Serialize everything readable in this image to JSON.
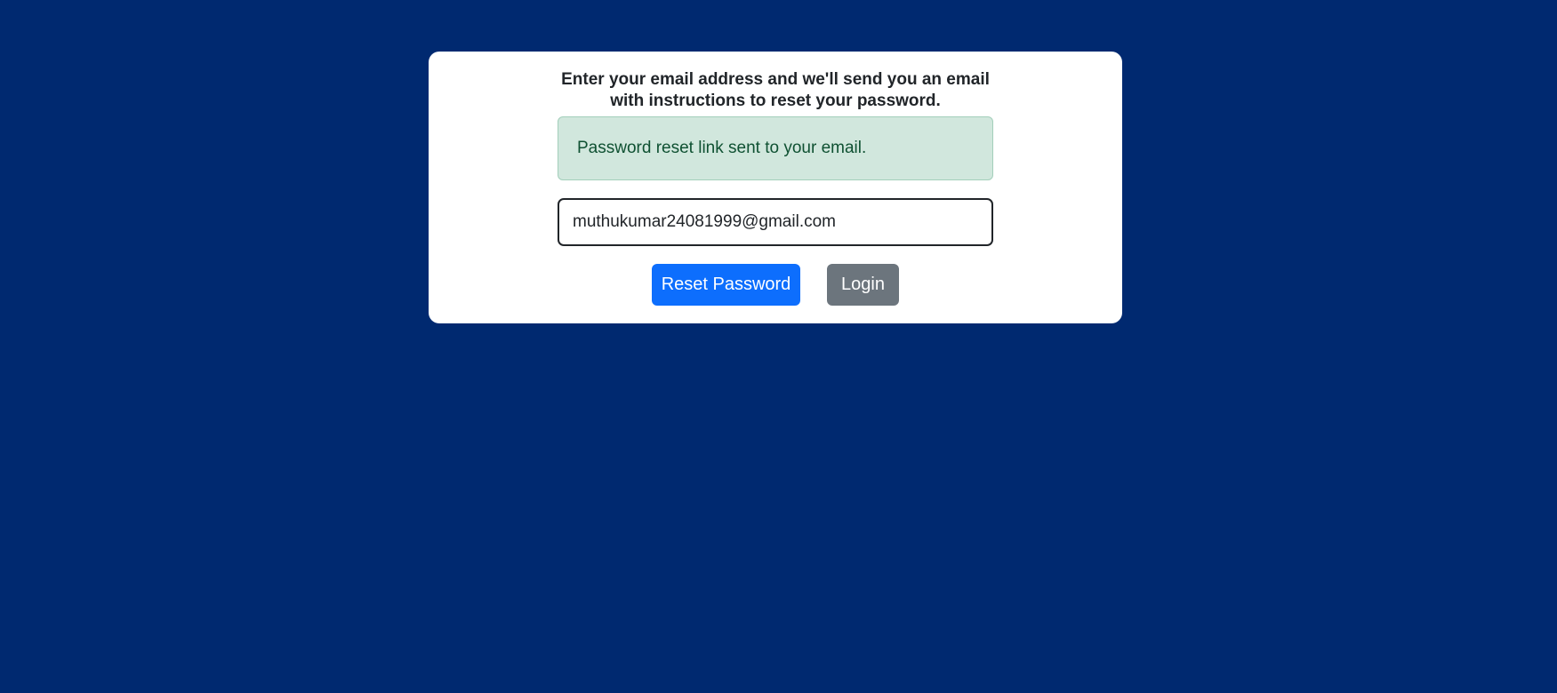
{
  "reset_card": {
    "instructions": "Enter your email address and we'll send you an email with instructions to reset your password.",
    "alert": {
      "message": "Password reset link sent to your email.",
      "status": "success",
      "background_color": "#d1e7dd",
      "text_color": "#0f5132"
    },
    "email_input": {
      "value": "muthukumar24081999@gmail.com",
      "type": "email"
    },
    "buttons": {
      "reset_label": "Reset Password",
      "login_label": "Login"
    }
  },
  "colors": {
    "page_background": "#002970",
    "card_background": "#ffffff",
    "primary": "#0d6efd",
    "secondary": "#6c757d"
  }
}
